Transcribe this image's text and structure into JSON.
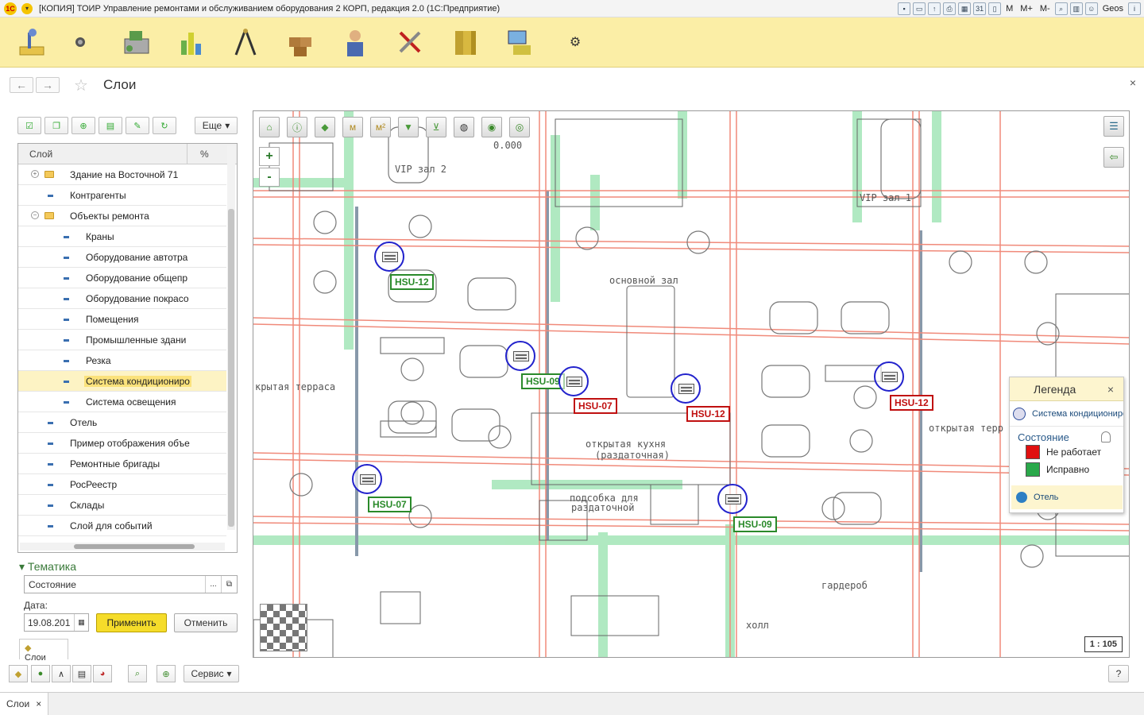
{
  "window": {
    "title": "[КОПИЯ] ТОИР Управление ремонтами и обслуживанием оборудования 2 КОРП, редакция 2.0   (1С:Предприятие)",
    "user": "Geos",
    "logo": "1С"
  },
  "sections": [
    "desktop-icon",
    "globe-icon",
    "printer-icon",
    "chart-icon",
    "tools-icon",
    "warehouse-icon",
    "worker-icon",
    "wrench-icon",
    "folders-icon",
    "computer-icon",
    "gear-icon"
  ],
  "page": {
    "title": "Слои",
    "close": "×"
  },
  "left": {
    "more_label": "Еще",
    "columns": {
      "layer": "Слой",
      "pct": "%"
    },
    "rows": [
      {
        "label": "Здание на Восточной 71",
        "level": 0,
        "kind": "folder",
        "state": "collapsed"
      },
      {
        "label": "Контрагенты",
        "level": 0,
        "kind": "item"
      },
      {
        "label": "Объекты ремонта",
        "level": 0,
        "kind": "folder",
        "state": "expanded"
      },
      {
        "label": "Краны",
        "level": 1,
        "kind": "item"
      },
      {
        "label": "Оборудование автотра",
        "level": 1,
        "kind": "item"
      },
      {
        "label": "Оборудование общепр",
        "level": 1,
        "kind": "item"
      },
      {
        "label": "Оборудование покрасо",
        "level": 1,
        "kind": "item"
      },
      {
        "label": "Помещения",
        "level": 1,
        "kind": "item"
      },
      {
        "label": "Промышленные здани",
        "level": 1,
        "kind": "item"
      },
      {
        "label": "Резка",
        "level": 1,
        "kind": "item"
      },
      {
        "label": "Система кондициониро",
        "level": 1,
        "kind": "item",
        "selected": true
      },
      {
        "label": "Система освещения",
        "level": 1,
        "kind": "item"
      },
      {
        "label": "Отель",
        "level": 0,
        "kind": "item"
      },
      {
        "label": "Пример отображения объе",
        "level": 0,
        "kind": "item"
      },
      {
        "label": "Ремонтные бригады",
        "level": 0,
        "kind": "item"
      },
      {
        "label": "РосРеестр",
        "level": 0,
        "kind": "item"
      },
      {
        "label": "Склады",
        "level": 0,
        "kind": "item"
      },
      {
        "label": "Слой для событий",
        "level": 0,
        "kind": "item"
      }
    ],
    "thematic_title": "Тематика",
    "thematic_value": "Состояние",
    "date_label": "Дата:",
    "date_value": "19.08.201",
    "apply": "Применить",
    "cancel": "Отменить",
    "layers_tab": "Слои"
  },
  "map": {
    "zoom_in": "+",
    "zoom_out": "-",
    "scale": "1 : 105",
    "rooms": [
      "VIP зал 2",
      "VIP зал 1",
      "основной зал",
      "крытая терраса",
      "открытая кухня",
      "(раздаточная)",
      "открытая терр",
      "подсобка для",
      "раздаточной",
      "гардероб",
      "холл",
      "0.000"
    ],
    "equipment": [
      {
        "id": "HSU-12",
        "status": "ok"
      },
      {
        "id": "HSU-09",
        "status": "ok"
      },
      {
        "id": "HSU-07",
        "status": "bad"
      },
      {
        "id": "HSU-12",
        "status": "bad"
      },
      {
        "id": "HSU-12",
        "status": "bad"
      },
      {
        "id": "HSU-07",
        "status": "ok"
      },
      {
        "id": "HSU-09",
        "status": "ok"
      }
    ],
    "legend": {
      "title": "Легенда",
      "layer": "Система кондициониро",
      "state_title": "Состояние",
      "items": [
        {
          "label": "Не работает",
          "color": "#e01010"
        },
        {
          "label": "Исправно",
          "color": "#2aa84a"
        }
      ],
      "layer2": "Отель"
    }
  },
  "bottom": {
    "service": "Сервис",
    "help": "?"
  },
  "taskbar": {
    "tab": "Слои",
    "close": "×"
  }
}
